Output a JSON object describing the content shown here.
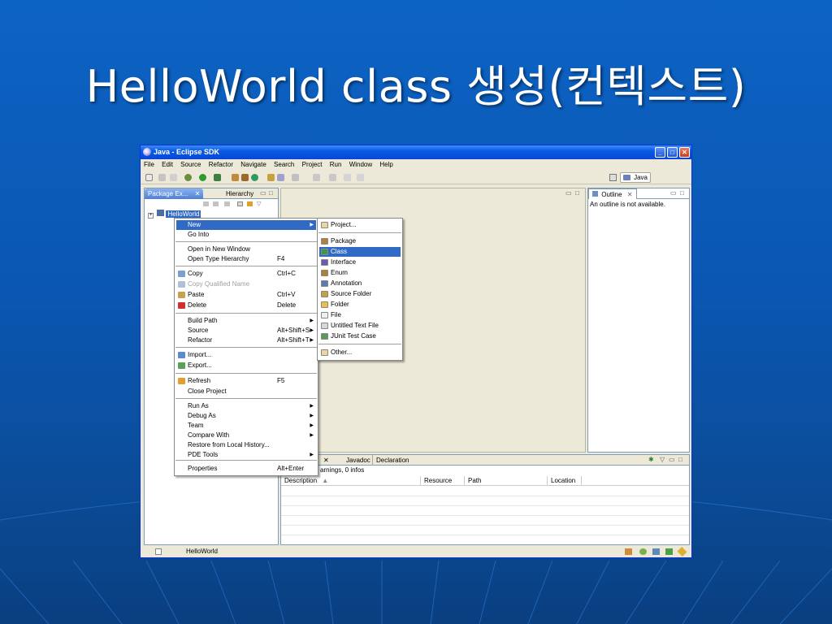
{
  "slide": {
    "title": "HelloWorld class 생성(컨텍스트)"
  },
  "window": {
    "title": "Java - Eclipse SDK",
    "controls": {
      "minimize": "_",
      "maximize": "□",
      "close": "✕"
    }
  },
  "menubar": [
    "File",
    "Edit",
    "Source",
    "Refactor",
    "Navigate",
    "Search",
    "Project",
    "Run",
    "Window",
    "Help"
  ],
  "perspective": {
    "label": "Java"
  },
  "package_explorer": {
    "tabs": [
      "Package Ex...",
      "Hierarchy"
    ],
    "close_glyph": "✕",
    "project": "HelloWorld"
  },
  "outline": {
    "tab": "Outline",
    "message": "An outline is not available."
  },
  "bottom_panel": {
    "tabs": [
      "Javadoc",
      "Declaration"
    ],
    "summary": "arnings, 0 infos",
    "columns": [
      "Description",
      "Resource",
      "Path",
      "Location"
    ]
  },
  "statusbar": {
    "text": "HelloWorld"
  },
  "context_menu": {
    "items": [
      {
        "label": "New",
        "shortcut": "",
        "submenu": true,
        "selected": true,
        "disabled": false,
        "icon": ""
      },
      {
        "label": "Go Into",
        "shortcut": "",
        "submenu": false,
        "selected": false,
        "disabled": false,
        "icon": ""
      },
      {
        "label": "Open in New Window",
        "shortcut": "",
        "submenu": false,
        "selected": false,
        "disabled": false,
        "icon": ""
      },
      {
        "label": "Open Type Hierarchy",
        "shortcut": "F4",
        "submenu": false,
        "selected": false,
        "disabled": false,
        "icon": ""
      },
      {
        "label": "Copy",
        "shortcut": "Ctrl+C",
        "submenu": false,
        "selected": false,
        "disabled": false,
        "icon": "copy-icon"
      },
      {
        "label": "Copy Qualified Name",
        "shortcut": "",
        "submenu": false,
        "selected": false,
        "disabled": true,
        "icon": "copy-qualified-icon"
      },
      {
        "label": "Paste",
        "shortcut": "Ctrl+V",
        "submenu": false,
        "selected": false,
        "disabled": false,
        "icon": "paste-icon"
      },
      {
        "label": "Delete",
        "shortcut": "Delete",
        "submenu": false,
        "selected": false,
        "disabled": false,
        "icon": "delete-icon"
      },
      {
        "label": "Build Path",
        "shortcut": "",
        "submenu": true,
        "selected": false,
        "disabled": false,
        "icon": ""
      },
      {
        "label": "Source",
        "shortcut": "Alt+Shift+S",
        "submenu": true,
        "selected": false,
        "disabled": false,
        "icon": ""
      },
      {
        "label": "Refactor",
        "shortcut": "Alt+Shift+T",
        "submenu": true,
        "selected": false,
        "disabled": false,
        "icon": ""
      },
      {
        "label": "Import...",
        "shortcut": "",
        "submenu": false,
        "selected": false,
        "disabled": false,
        "icon": "import-icon"
      },
      {
        "label": "Export...",
        "shortcut": "",
        "submenu": false,
        "selected": false,
        "disabled": false,
        "icon": "export-icon"
      },
      {
        "label": "Refresh",
        "shortcut": "F5",
        "submenu": false,
        "selected": false,
        "disabled": false,
        "icon": "refresh-icon"
      },
      {
        "label": "Close Project",
        "shortcut": "",
        "submenu": false,
        "selected": false,
        "disabled": false,
        "icon": ""
      },
      {
        "label": "Run As",
        "shortcut": "",
        "submenu": true,
        "selected": false,
        "disabled": false,
        "icon": ""
      },
      {
        "label": "Debug As",
        "shortcut": "",
        "submenu": true,
        "selected": false,
        "disabled": false,
        "icon": ""
      },
      {
        "label": "Team",
        "shortcut": "",
        "submenu": true,
        "selected": false,
        "disabled": false,
        "icon": ""
      },
      {
        "label": "Compare With",
        "shortcut": "",
        "submenu": true,
        "selected": false,
        "disabled": false,
        "icon": ""
      },
      {
        "label": "Restore from Local History...",
        "shortcut": "",
        "submenu": false,
        "selected": false,
        "disabled": false,
        "icon": ""
      },
      {
        "label": "PDE Tools",
        "shortcut": "",
        "submenu": true,
        "selected": false,
        "disabled": false,
        "icon": ""
      },
      {
        "label": "Properties",
        "shortcut": "Alt+Enter",
        "submenu": false,
        "selected": false,
        "disabled": false,
        "icon": ""
      }
    ]
  },
  "new_submenu": {
    "items": [
      {
        "label": "Project...",
        "selected": false,
        "icon": "project-icon"
      },
      {
        "label": "Package",
        "selected": false,
        "icon": "package-icon"
      },
      {
        "label": "Class",
        "selected": true,
        "icon": "class-icon"
      },
      {
        "label": "Interface",
        "selected": false,
        "icon": "interface-icon"
      },
      {
        "label": "Enum",
        "selected": false,
        "icon": "enum-icon"
      },
      {
        "label": "Annotation",
        "selected": false,
        "icon": "annotation-icon"
      },
      {
        "label": "Source Folder",
        "selected": false,
        "icon": "source-folder-icon"
      },
      {
        "label": "Folder",
        "selected": false,
        "icon": "folder-icon"
      },
      {
        "label": "File",
        "selected": false,
        "icon": "file-icon"
      },
      {
        "label": "Untitled Text File",
        "selected": false,
        "icon": "text-file-icon"
      },
      {
        "label": "JUnit Test Case",
        "selected": false,
        "icon": "junit-icon"
      },
      {
        "label": "Other...",
        "selected": false,
        "icon": "other-icon"
      }
    ]
  },
  "colors": {
    "selection": "#316ac5",
    "titlebar": "#0a5ae4",
    "slide_background": "#0d63c4"
  }
}
